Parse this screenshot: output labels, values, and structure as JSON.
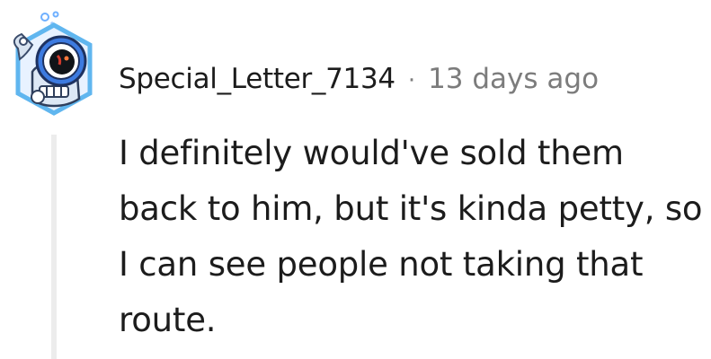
{
  "comment": {
    "author": "Special_Letter_7134",
    "separator": "·",
    "timestamp": "13 days ago",
    "body": "I definitely would've sold them back to him, but it's kinda petty, so I can see people not taking that route.",
    "avatar_icon": "robot-avatar-icon"
  },
  "colors": {
    "text": "#1c1c1c",
    "muted": "#7c7c7c",
    "thread_line": "#ececec",
    "avatar_blue": "#3d7be0"
  }
}
